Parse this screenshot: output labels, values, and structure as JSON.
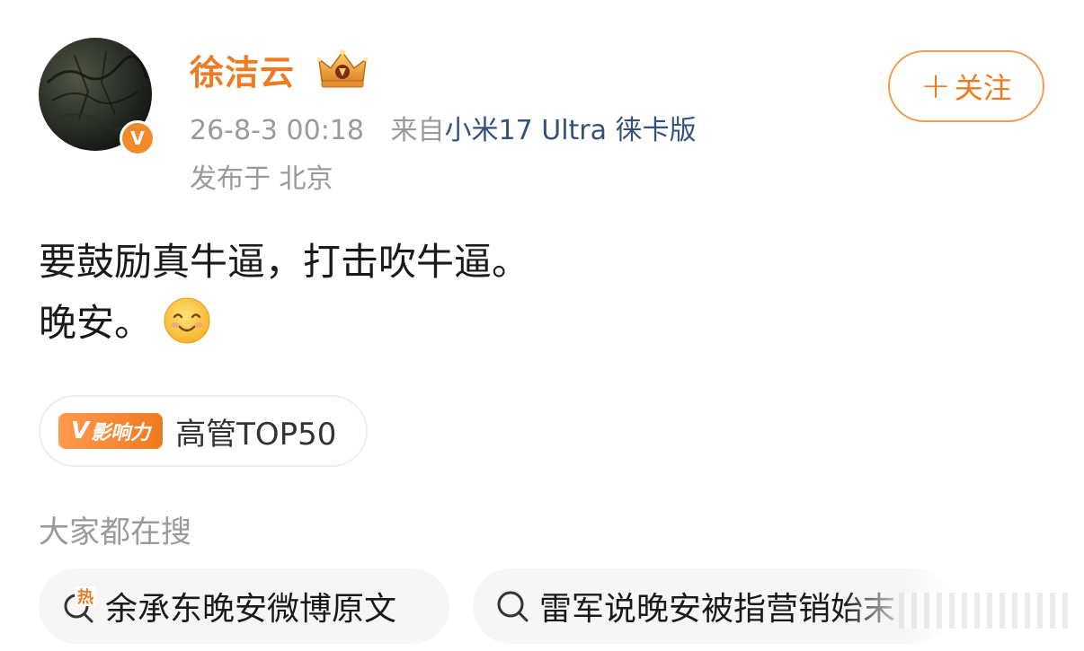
{
  "post": {
    "author": {
      "name": "徐洁云",
      "verified_badge": "V",
      "crown_icon": "crown-icon"
    },
    "meta": {
      "timestamp": "26-8-3 00:18",
      "source_prefix": "来自",
      "device": "小米17 Ultra 徕卡版",
      "location": "发布于 北京"
    },
    "follow": {
      "plus": "+",
      "label": "关注"
    },
    "content": {
      "line1": "要鼓励真牛逼，打击吹牛逼。",
      "line2": "晚安。",
      "emoji": "smile-emoji-icon"
    },
    "influence": {
      "badge_v": "V",
      "badge_text": "影响力",
      "label": "高管TOP50"
    }
  },
  "search": {
    "heading": "大家都在搜",
    "items": [
      {
        "icon": "hot-search-icon",
        "hot_mark": "热",
        "text": "余承东晚安微博原文"
      },
      {
        "icon": "search-icon",
        "text": "雷军说晚安被指营销始末"
      }
    ]
  },
  "colors": {
    "accent": "#f07a20",
    "device_link": "#33527e",
    "meta_gray": "#9a9a9a"
  }
}
